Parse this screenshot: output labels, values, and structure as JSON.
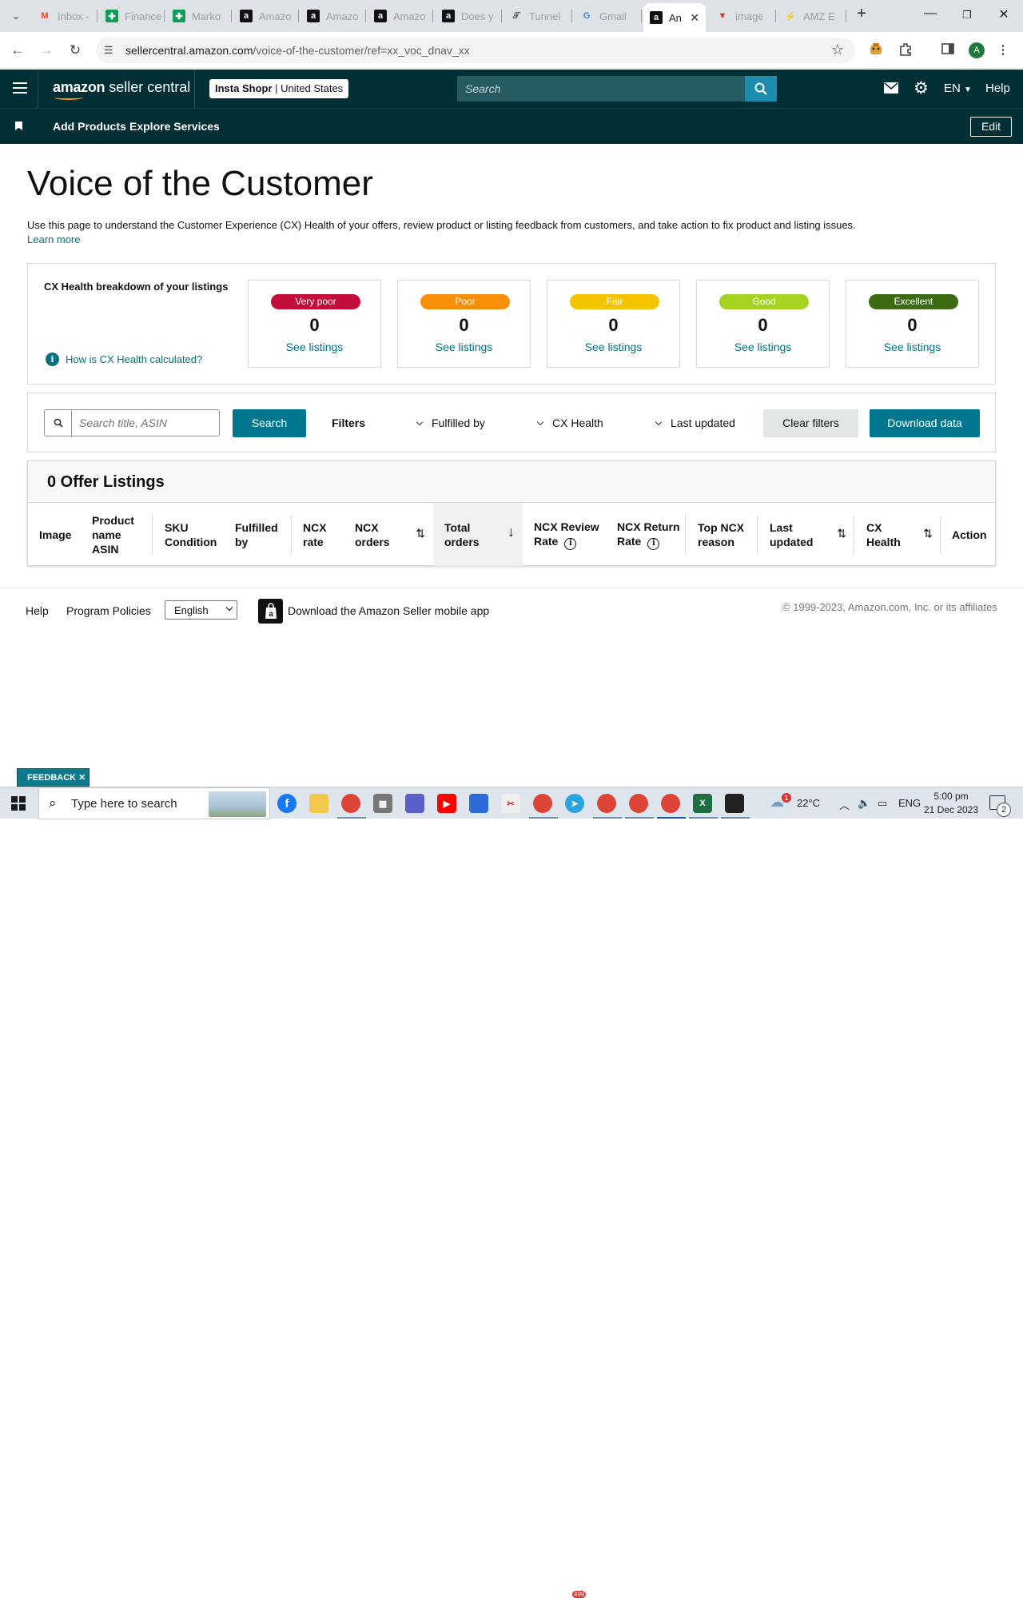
{
  "browser": {
    "tabs": [
      {
        "label": "Inbox -",
        "icon": "gmail-icon",
        "color": "#ea4335"
      },
      {
        "label": "Finance",
        "icon": "sheets-icon",
        "color": "#0f9d58"
      },
      {
        "label": "Marko",
        "icon": "sheets-icon",
        "color": "#0f9d58"
      },
      {
        "label": "Amazo",
        "icon": "amazon-icon",
        "color": "#111111"
      },
      {
        "label": "Amazo",
        "icon": "amazon-icon",
        "color": "#111111"
      },
      {
        "label": "Amazo",
        "icon": "amazon-icon",
        "color": "#111111"
      },
      {
        "label": "Does y",
        "icon": "amazon-icon",
        "color": "#111111"
      },
      {
        "label": "Tunnel",
        "icon": "tunnel-icon",
        "color": "#555555"
      },
      {
        "label": "Gmail",
        "icon": "google-icon",
        "color": "#4285f4"
      },
      {
        "label": "An",
        "icon": "amazon-icon",
        "color": "#111111"
      },
      {
        "label": "image",
        "icon": "image-icon",
        "color": "#d93025"
      },
      {
        "label": "AMZ E",
        "icon": "amz-icon",
        "color": "#f29900"
      }
    ],
    "url_host": "sellercentral.amazon.com",
    "url_path": "/voice-of-the-customer/ref=xx_voc_dnav_xx",
    "profile_initial": "A"
  },
  "header": {
    "logo_main": "amazon",
    "logo_sub": "seller central",
    "store_name": "Insta Shopr",
    "store_sep": " | ",
    "store_region": "United States",
    "search_placeholder": "Search",
    "language": "EN",
    "help": "Help"
  },
  "subnav": {
    "add_products": "Add Products",
    "explore_services": "Explore Services",
    "edit": "Edit"
  },
  "page": {
    "title": "Voice of the Customer",
    "intro": "Use this page to understand the Customer Experience (CX) Health of your offers, review product or listing feedback from customers, and take action to fix product and listing issues.",
    "learn_more": "Learn more"
  },
  "cx": {
    "heading": "CX Health breakdown of your listings",
    "how_link": "How is CX Health calculated?",
    "cards": [
      {
        "label": "Very poor",
        "count": "0",
        "link": "See listings",
        "color": "#c40c3a"
      },
      {
        "label": "Poor",
        "count": "0",
        "link": "See listings",
        "color": "#f98e07"
      },
      {
        "label": "Fair",
        "count": "0",
        "link": "See listings",
        "color": "#f5c400"
      },
      {
        "label": "Good",
        "count": "0",
        "link": "See listings",
        "color": "#a4d421"
      },
      {
        "label": "Excellent",
        "count": "0",
        "link": "See listings",
        "color": "#3d6b12"
      }
    ]
  },
  "filters": {
    "search_placeholder": "Search title, ASIN",
    "search_button": "Search",
    "label": "Filters",
    "fulfilled_by": "Fulfilled by",
    "cx_health": "CX Health",
    "last_updated": "Last updated",
    "clear": "Clear filters",
    "download": "Download data"
  },
  "listings": {
    "title": "0 Offer Listings",
    "columns": [
      {
        "l1": "Image",
        "l2": "",
        "l3": ""
      },
      {
        "l1": "Product",
        "l2": "name",
        "l3": "ASIN"
      },
      {
        "l1": "SKU",
        "l2": "Condition",
        "l3": ""
      },
      {
        "l1": "Fulfilled by",
        "l2": "",
        "l3": ""
      },
      {
        "l1": "NCX",
        "l2": "rate",
        "l3": ""
      },
      {
        "l1": "NCX",
        "l2": "orders",
        "l3": ""
      },
      {
        "l1": "Total",
        "l2": "orders",
        "l3": ""
      },
      {
        "l1": "NCX Review",
        "l2": "Rate",
        "l3": ""
      },
      {
        "l1": "NCX Return",
        "l2": "Rate",
        "l3": ""
      },
      {
        "l1": "Top NCX",
        "l2": "reason",
        "l3": ""
      },
      {
        "l1": "Last",
        "l2": "updated",
        "l3": ""
      },
      {
        "l1": "CX",
        "l2": "Health",
        "l3": ""
      },
      {
        "l1": "Action",
        "l2": "",
        "l3": ""
      }
    ]
  },
  "footer": {
    "help": "Help",
    "policies": "Program Policies",
    "language": "English",
    "app": "Download the Amazon Seller mobile app",
    "copyright": "© 1999-2023, Amazon.com, Inc. or its affiliates"
  },
  "feedback": "FEEDBACK ✕",
  "taskbar": {
    "search_placeholder": "Type here to search",
    "weather": "22°C",
    "lang": "ENG",
    "time": "5:00 pm",
    "date": "21 Dec 2023",
    "notifications": "2",
    "telegram_badge": "499",
    "weather_badge": "1"
  }
}
